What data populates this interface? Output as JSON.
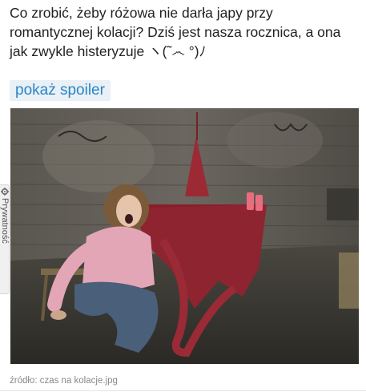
{
  "post": {
    "text": "Co zrobić, żeby różowa nie darła japy przy romantycznej kolacji? Dziś jest nasza rocznica, a ona jak zwykle histeryzuje ヽ(˜෴ °)ﾉ",
    "spoiler_label": "pokaż spoiler"
  },
  "embed": {
    "source_label": "źródło: czas na kolacje.jpg"
  },
  "privacy_tab": {
    "label": "Prywatność",
    "icon": "gear-icon"
  }
}
